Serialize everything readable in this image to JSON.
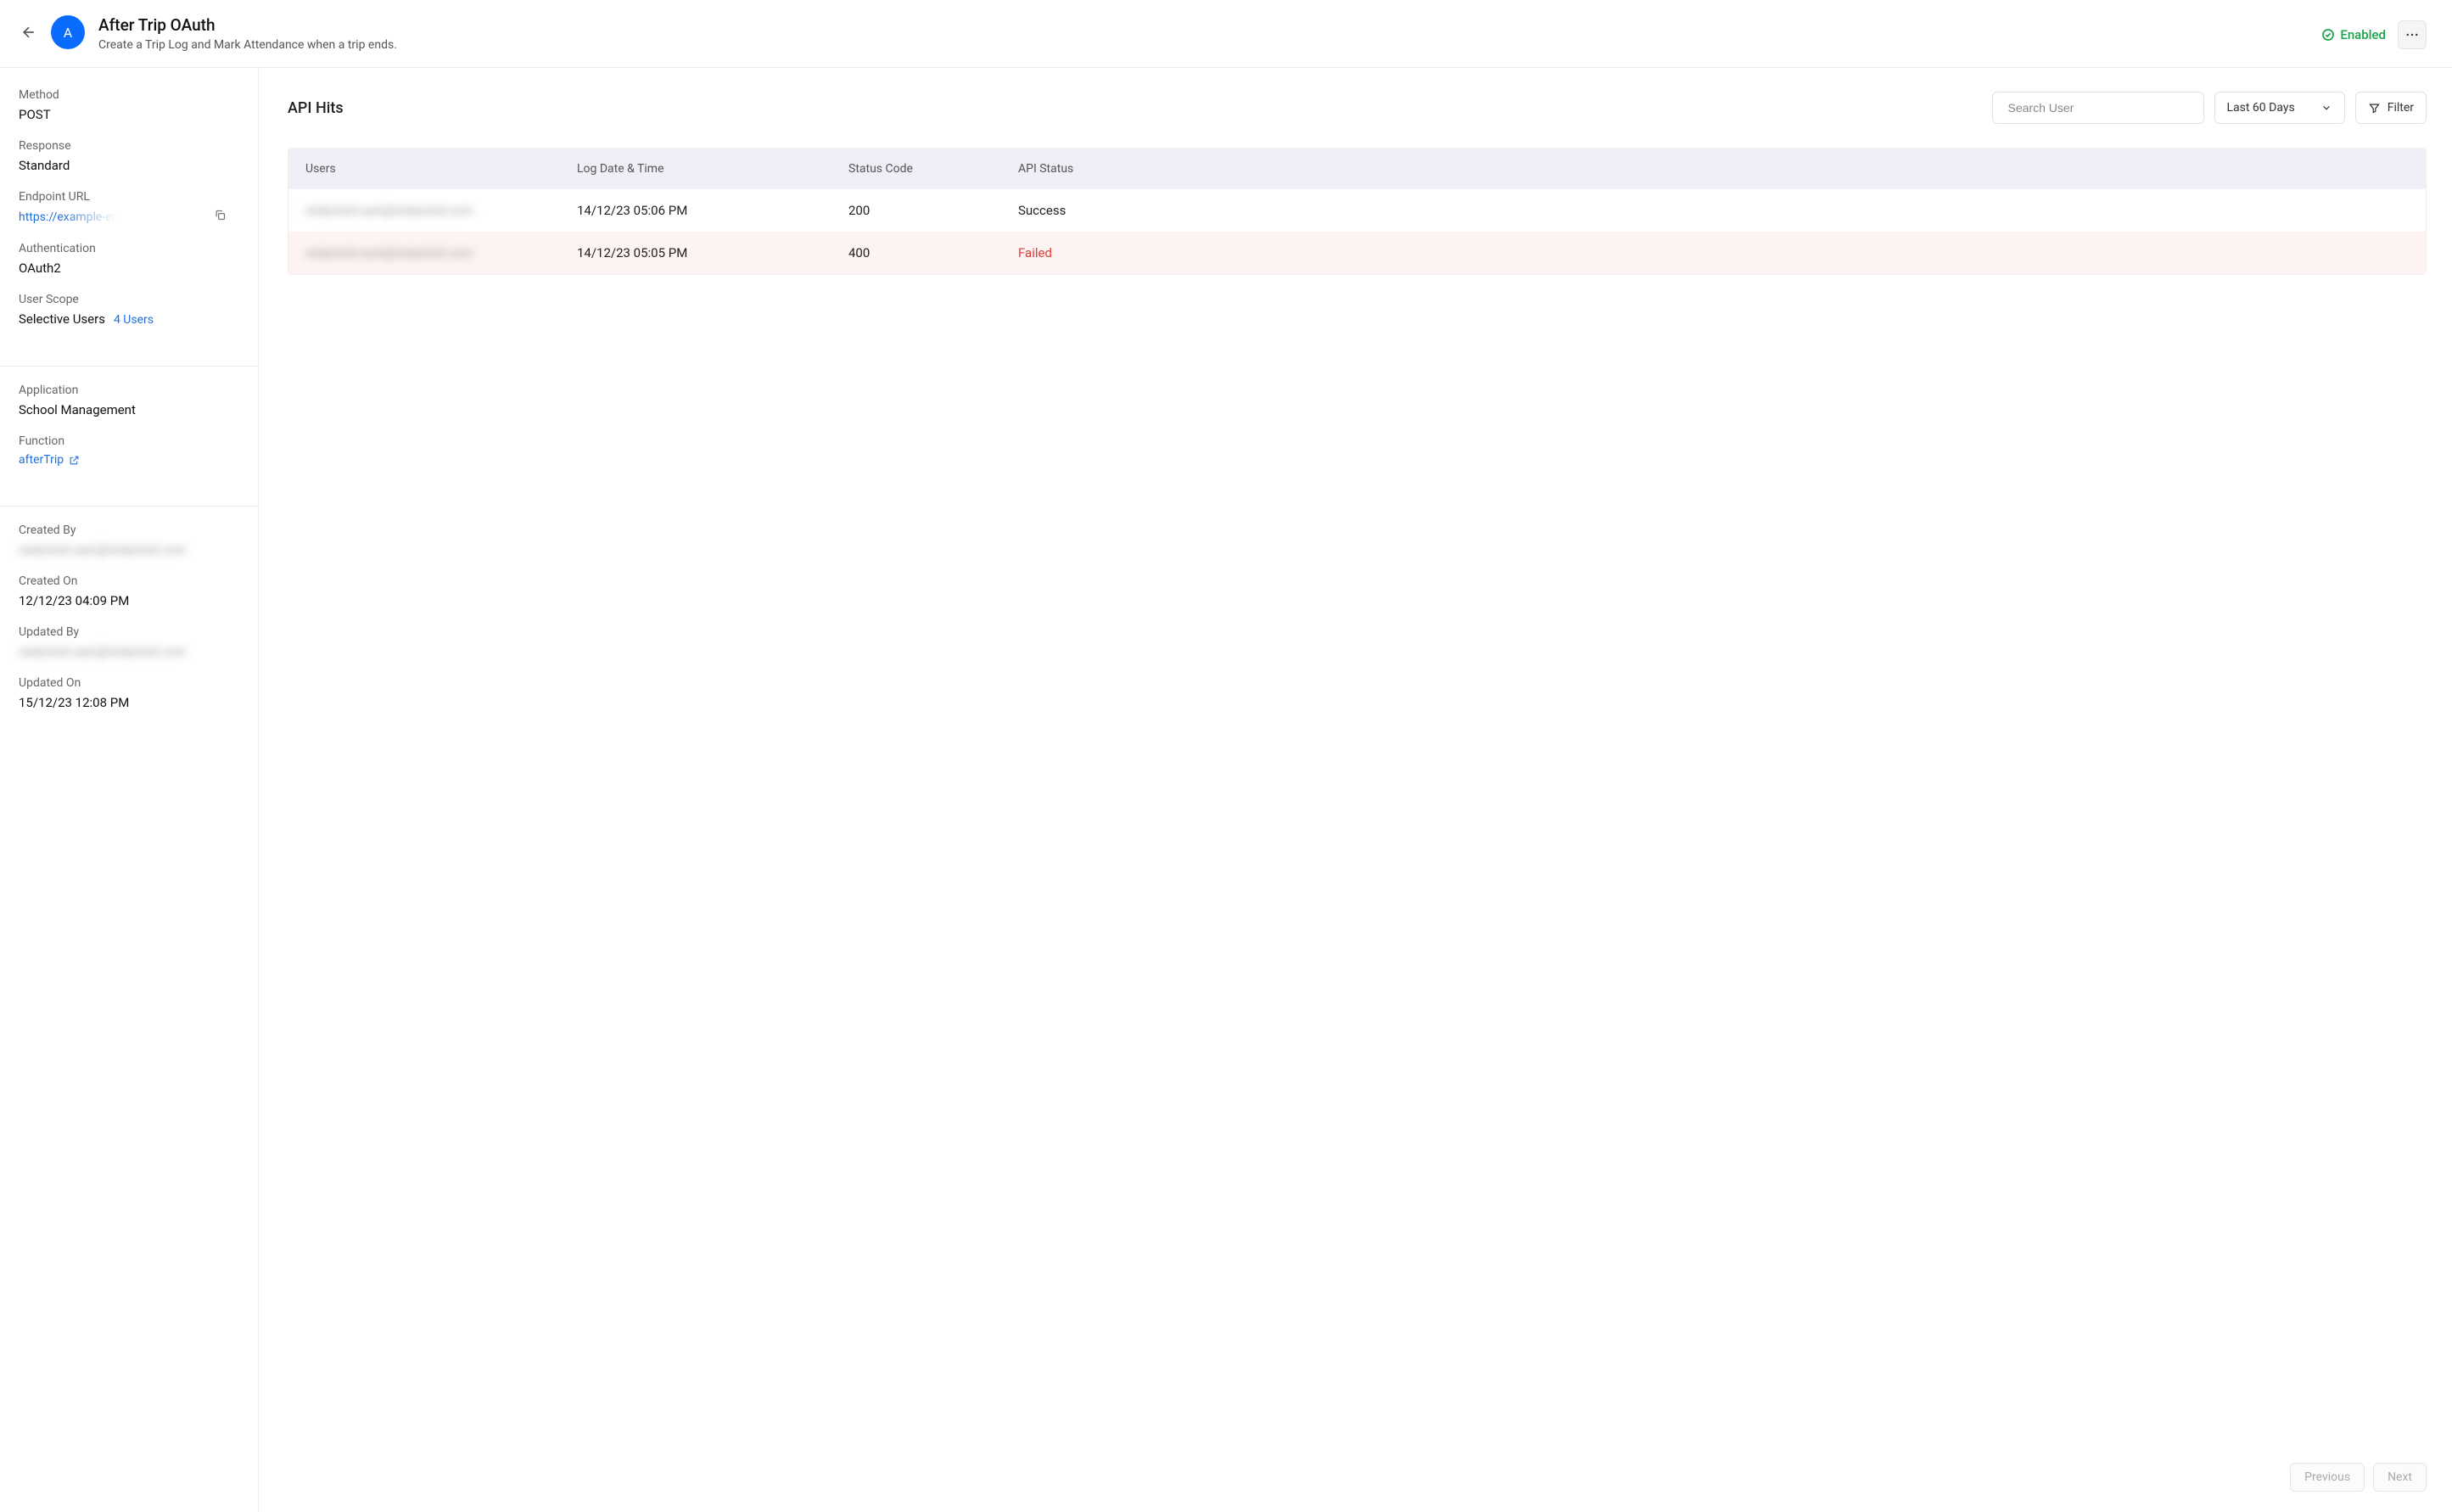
{
  "header": {
    "avatar_letter": "A",
    "title": "After Trip OAuth",
    "subtitle": "Create a Trip Log and Mark Attendance when a trip ends.",
    "status_label": "Enabled"
  },
  "sidebar": {
    "method": {
      "label": "Method",
      "value": "POST"
    },
    "response": {
      "label": "Response",
      "value": "Standard"
    },
    "endpoint": {
      "label": "Endpoint URL",
      "value": "https://example-endpoint-url-placeholder"
    },
    "auth": {
      "label": "Authentication",
      "value": "OAuth2"
    },
    "scope": {
      "label": "User Scope",
      "value": "Selective Users",
      "link": "4 Users"
    },
    "application": {
      "label": "Application",
      "value": "School Management"
    },
    "function": {
      "label": "Function",
      "value": "afterTrip"
    },
    "created_by": {
      "label": "Created By",
      "value": "redacted-user@redacted.com"
    },
    "created_on": {
      "label": "Created On",
      "value": "12/12/23 04:09 PM"
    },
    "updated_by": {
      "label": "Updated By",
      "value": "redacted-user@redacted.com"
    },
    "updated_on": {
      "label": "Updated On",
      "value": "15/12/23 12:08 PM"
    }
  },
  "main": {
    "title": "API Hits",
    "search_placeholder": "Search User",
    "range_label": "Last 60 Days",
    "filter_label": "Filter",
    "columns": {
      "users": "Users",
      "log_date": "Log Date & Time",
      "status_code": "Status Code",
      "api_status": "API Status"
    },
    "rows": [
      {
        "user": "redacted-user@redacted.com",
        "date": "14/12/23 05:06 PM",
        "code": "200",
        "status": "Success",
        "failed": false
      },
      {
        "user": "redacted-user@redacted.com",
        "date": "14/12/23 05:05 PM",
        "code": "400",
        "status": "Failed",
        "failed": true
      }
    ],
    "pager": {
      "prev": "Previous",
      "next": "Next"
    }
  }
}
